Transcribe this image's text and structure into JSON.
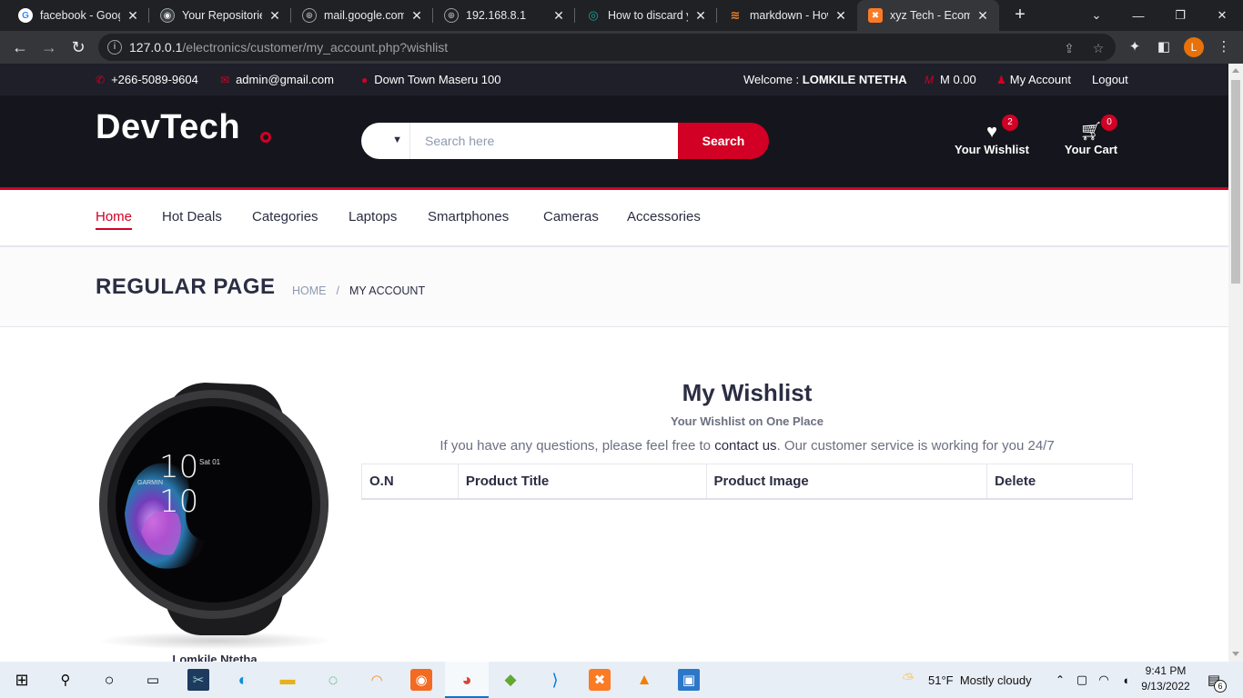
{
  "browser": {
    "tabs": [
      {
        "title": "facebook - Googl",
        "icon": "google-icon"
      },
      {
        "title": "Your Repositories",
        "icon": "github-icon"
      },
      {
        "title": "mail.google.com",
        "icon": "globe-icon"
      },
      {
        "title": "192.168.8.1",
        "icon": "globe-icon"
      },
      {
        "title": "How to discard y",
        "icon": "eye-icon"
      },
      {
        "title": "markdown - How",
        "icon": "stackoverflow-icon"
      },
      {
        "title": "xyz Tech - Ecomm",
        "icon": "xampp-icon",
        "active": true
      }
    ],
    "new_tab_label": "+",
    "url_host": "127.0.0.1",
    "url_path": "/electronics/customer/my_account.php?wishlist",
    "profile_initial": "L"
  },
  "top_header": {
    "phone": "+266-5089-9604",
    "email": "admin@gmail.com",
    "address": "Down Town Maseru 100",
    "welcome_prefix": "Welcome : ",
    "user_name": "LOMKILE NTETHA",
    "currency_symbol": "M",
    "balance": "M 0.00",
    "my_account": "My Account",
    "logout": "Logout"
  },
  "header": {
    "logo": "DevTech",
    "search_placeholder": "Search here",
    "search_button": "Search",
    "wishlist_label": "Your Wishlist",
    "wishlist_count": "2",
    "cart_label": "Your Cart",
    "cart_count": "0"
  },
  "nav": {
    "items": [
      "Home",
      "Hot Deals",
      "Categories",
      "Laptops",
      "Smartphones",
      "Cameras",
      "Accessories"
    ],
    "active": "Home"
  },
  "breadcrumb": {
    "title": "REGULAR PAGE",
    "home": "HOME",
    "current": "MY ACCOUNT"
  },
  "profile": {
    "image_alt": "smartwatch",
    "watch_brand": "GARMIN",
    "watch_hour": "10",
    "watch_minute": "10",
    "watch_date": "Sat 01",
    "name": "Lomkile Ntetha"
  },
  "wishlist": {
    "title": "My Wishlist",
    "subtitle": "Your Wishlist on One Place",
    "note_before": "If you have any questions, please feel free to ",
    "note_link": "contact us",
    "note_after": ". Our customer service is working for you 24/7",
    "columns": [
      "O.N",
      "Product Title",
      "Product Image",
      "Delete"
    ]
  },
  "taskbar": {
    "weather_temp": "51°F",
    "weather_desc": "Mostly cloudy",
    "time": "9:41 PM",
    "date": "9/13/2022",
    "notification_count": "6"
  },
  "colors": {
    "accent": "#d10024",
    "header_dark": "#15161d",
    "top_header": "#1e1f29",
    "text_dark": "#2b2d42"
  }
}
